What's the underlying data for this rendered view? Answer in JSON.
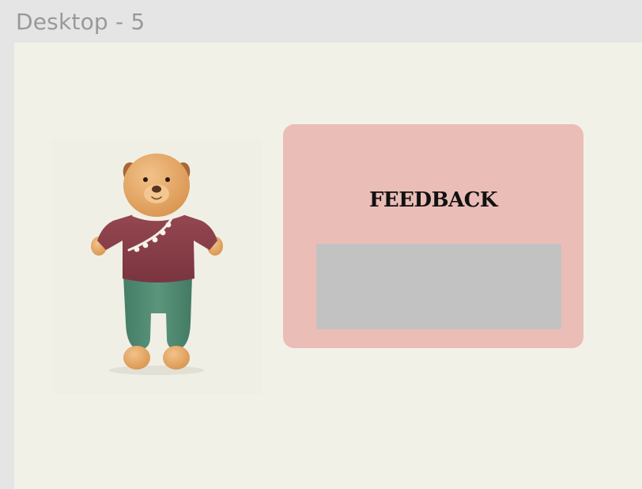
{
  "frame": {
    "label": "Desktop - 5"
  },
  "character": {
    "name": "bear-mascot-image"
  },
  "feedback": {
    "title": "FEEDBACK",
    "input_value": ""
  },
  "colors": {
    "app_bg": "#e5e5e5",
    "artboard_bg": "#f2f1e8",
    "card_bg": "#ebbdb7",
    "input_bg": "#c2c2c2",
    "shirt": "#8a3f49",
    "pants": "#4f8a72",
    "fur": "#e6a866"
  }
}
